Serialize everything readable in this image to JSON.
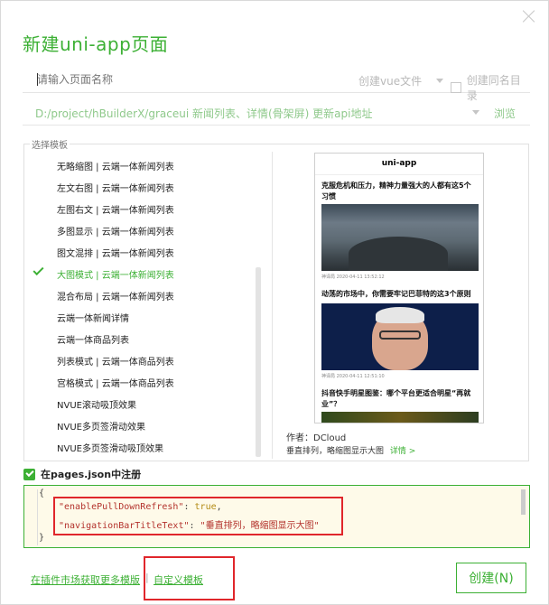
{
  "dialog": {
    "title": "新建uni-app页面"
  },
  "name_row": {
    "input_placeholder": "请输入页面名称",
    "input_value": "",
    "file_type": "创建vue文件",
    "same_dir_label": "创建同名目录",
    "same_dir_checked": false
  },
  "path_row": {
    "path": "D:/project/hBuilderX/graceui 新闻列表、详情(骨架屏) 更新api地址",
    "browse_label": "浏览"
  },
  "templates": {
    "group_label": "选择模板",
    "items": [
      "无略缩图 | 云端一体新闻列表",
      "左文右图 | 云端一体新闻列表",
      "左图右文 | 云端一体新闻列表",
      "多图显示 | 云端一体新闻列表",
      "图文混排 | 云端一体新闻列表",
      "大图模式 | 云端一体新闻列表",
      "混合布局 | 云端一体新闻列表",
      "云端一体新闻详情",
      "云端一体商品列表",
      "列表模式 | 云端一体商品列表",
      "宫格模式 | 云端一体商品列表",
      "NVUE滚动吸顶效果",
      "NVUE多页签滑动效果",
      "NVUE多页签滑动吸顶效果"
    ],
    "selected_index": 5
  },
  "preview": {
    "header": "uni-app",
    "news": [
      {
        "title": "克服危机和压力，精神力量强大的人都有这5个习惯",
        "meta": "神译局  2020-04-11 13:52:12"
      },
      {
        "title": "动荡的市场中，你需要牢记巴菲特的这3个原则",
        "meta": "神译局  2020-04-11 12:51:10"
      },
      {
        "title": "抖音快手明星图鉴：哪个平台更适合明星“再就业”？",
        "meta": ""
      }
    ],
    "author": "作者：DCloud",
    "description": "垂直排列，略缩图显示大图",
    "detail_link": "详情 >"
  },
  "register": {
    "label": "在pages.json中注册",
    "checked": true,
    "code": {
      "open": "{",
      "line1_key": "\"enablePullDownRefresh\"",
      "line1_sep": ": ",
      "line1_val": "true",
      "line1_end": ",",
      "line2_key": "\"navigationBarTitleText\"",
      "line2_sep": ": ",
      "line2_val": "\"垂直排列，略缩图显示大图\"",
      "close": "}"
    }
  },
  "footer": {
    "market_link": "在插件市场获取更多模版",
    "separator": "|",
    "custom_link": "自定义模板",
    "create_button": "创建(N)"
  },
  "colors": {
    "accent": "#3cb034",
    "highlight_border": "#e0262b",
    "code_bg": "#fefae9"
  }
}
